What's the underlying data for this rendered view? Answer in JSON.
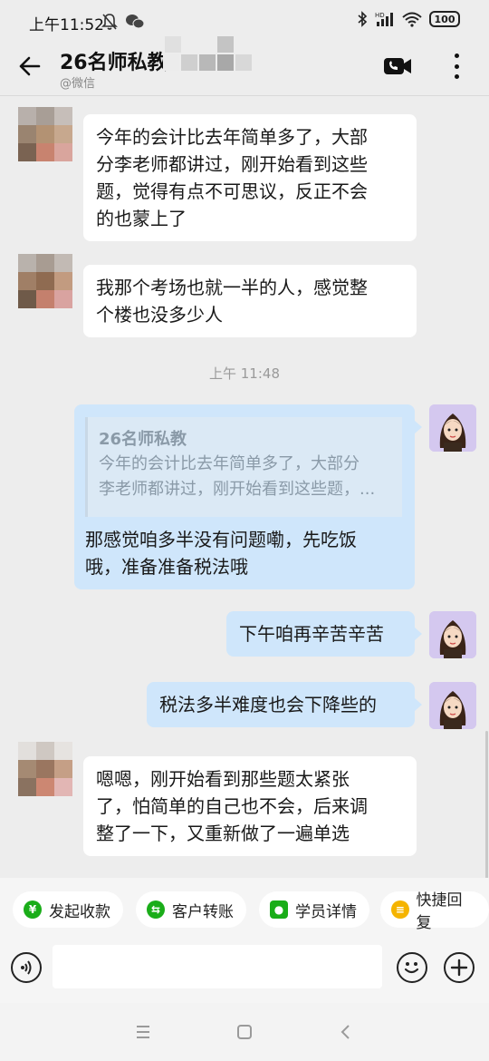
{
  "status_bar": {
    "time": "上午11:52",
    "battery": "100"
  },
  "header": {
    "title": "26名师私教",
    "subtitle": "@微信"
  },
  "messages": [
    {
      "direction": "in",
      "text_lines": [
        "今年的会计比去年简单多了，大部",
        "分李老师都讲过，刚开始看到这些",
        "题，觉得有点不可思议，反正不会",
        "的也蒙上了"
      ]
    },
    {
      "direction": "in",
      "text_lines": [
        "我那个考场也就一半的人，感觉整",
        "个楼也没多少人"
      ]
    },
    {
      "timestamp": "上午 11:48"
    },
    {
      "direction": "out",
      "quote": {
        "sender": "26名师私教",
        "text_lines": [
          "今年的会计比去年简单多了，大部分",
          "李老师都讲过，刚开始看到这些题，..."
        ]
      },
      "text_lines": [
        "那感觉咱多半没有问题嘞，先吃饭",
        "哦，准备准备税法哦"
      ]
    },
    {
      "direction": "out",
      "text_lines": [
        "下午咱再辛苦辛苦"
      ]
    },
    {
      "direction": "out",
      "text_lines": [
        "税法多半难度也会下降些的"
      ]
    },
    {
      "direction": "in",
      "text_lines": [
        "嗯嗯，刚开始看到那些题太紧张",
        "了，怕简单的自己也不会，后来调",
        "整了一下，又重新做了一遍单选"
      ]
    }
  ],
  "quick_actions": [
    {
      "label": "发起收款",
      "icon": "yen-icon",
      "color": "#1aad19"
    },
    {
      "label": "客户转账",
      "icon": "transfer-icon",
      "color": "#1aad19"
    },
    {
      "label": "学员详情",
      "icon": "user-icon",
      "color": "#1aad19"
    },
    {
      "label": "快捷回复",
      "icon": "reply-icon",
      "color": "#f5b400"
    }
  ],
  "input": {
    "placeholder": ""
  }
}
